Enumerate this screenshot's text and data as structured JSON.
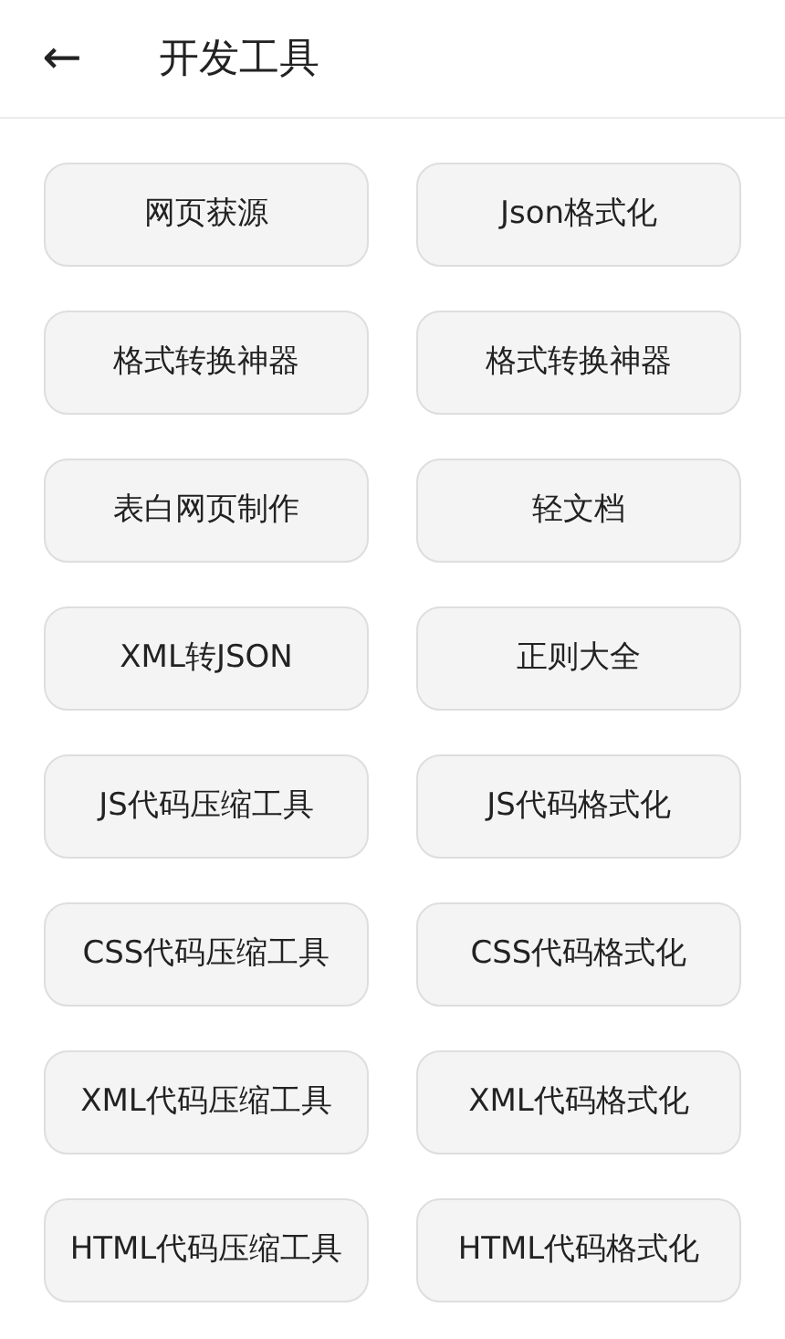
{
  "header": {
    "back_icon": "←",
    "title": "开发工具"
  },
  "tools": [
    {
      "label": "网页获源"
    },
    {
      "label": "Json格式化"
    },
    {
      "label": "格式转换神器"
    },
    {
      "label": "格式转换神器"
    },
    {
      "label": "表白网页制作"
    },
    {
      "label": "轻文档"
    },
    {
      "label": "XML转JSON"
    },
    {
      "label": "正则大全"
    },
    {
      "label": "JS代码压缩工具"
    },
    {
      "label": "JS代码格式化"
    },
    {
      "label": "CSS代码压缩工具"
    },
    {
      "label": "CSS代码格式化"
    },
    {
      "label": "XML代码压缩工具"
    },
    {
      "label": "XML代码格式化"
    },
    {
      "label": "HTML代码压缩工具"
    },
    {
      "label": "HTML代码格式化"
    }
  ]
}
